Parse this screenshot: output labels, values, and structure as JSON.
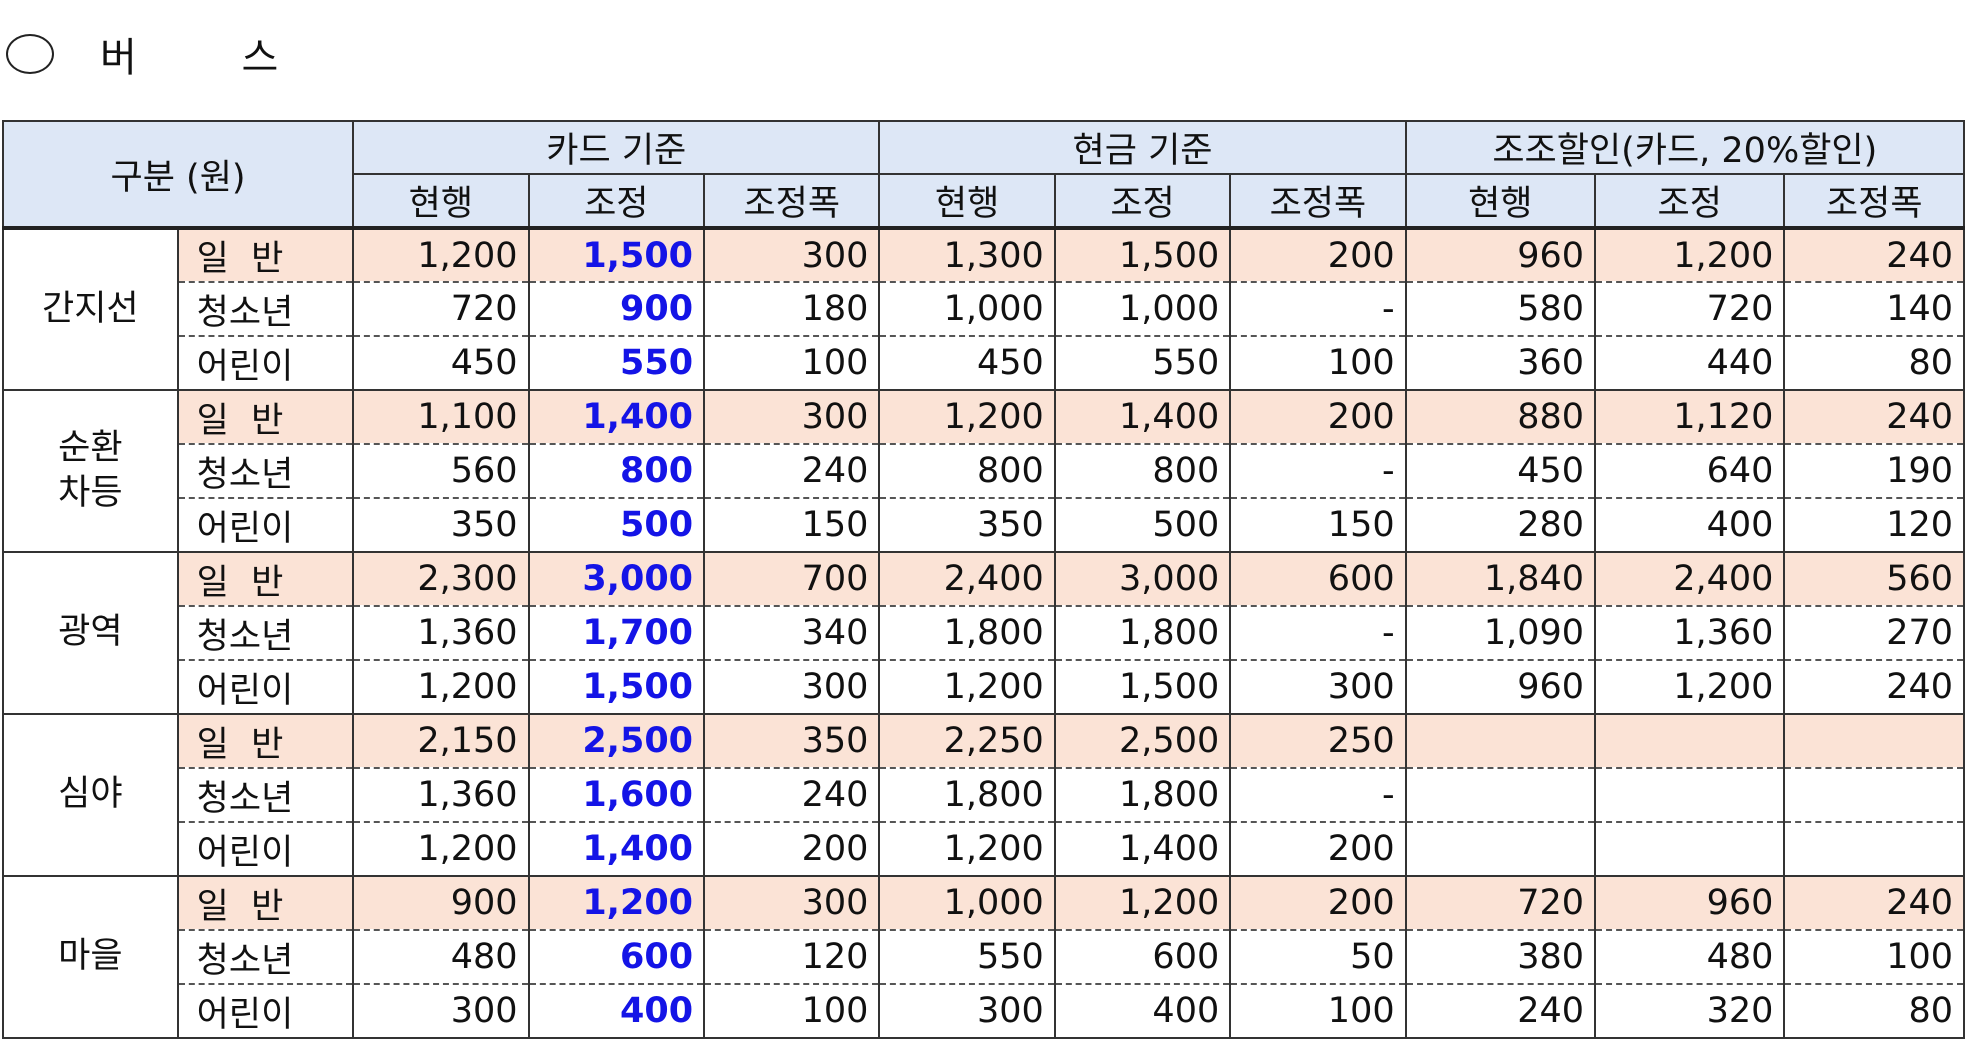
{
  "title": {
    "symbol": "○",
    "text": "버 스"
  },
  "table": {
    "header": {
      "corner": "구분 (원)",
      "groups": [
        "카드 기준",
        "현금 기준",
        "조조할인(카드, 20%할인)"
      ],
      "sub": [
        "현행",
        "조정",
        "조정폭",
        "현행",
        "조정",
        "조정폭",
        "현행",
        "조정",
        "조정폭"
      ]
    },
    "groups": [
      {
        "name": "간지선",
        "rows": [
          {
            "label": "일  반",
            "values": [
              "1,200",
              "1,500",
              "300",
              "1,300",
              "1,500",
              "200",
              "960",
              "1,200",
              "240"
            ]
          },
          {
            "label": "청소년",
            "values": [
              "720",
              "900",
              "180",
              "1,000",
              "1,000",
              "-",
              "580",
              "720",
              "140"
            ]
          },
          {
            "label": "어린이",
            "values": [
              "450",
              "550",
              "100",
              "450",
              "550",
              "100",
              "360",
              "440",
              "80"
            ]
          }
        ]
      },
      {
        "name": "순환\n차등",
        "rows": [
          {
            "label": "일  반",
            "values": [
              "1,100",
              "1,400",
              "300",
              "1,200",
              "1,400",
              "200",
              "880",
              "1,120",
              "240"
            ]
          },
          {
            "label": "청소년",
            "values": [
              "560",
              "800",
              "240",
              "800",
              "800",
              "-",
              "450",
              "640",
              "190"
            ]
          },
          {
            "label": "어린이",
            "values": [
              "350",
              "500",
              "150",
              "350",
              "500",
              "150",
              "280",
              "400",
              "120"
            ]
          }
        ]
      },
      {
        "name": "광역",
        "rows": [
          {
            "label": "일  반",
            "values": [
              "2,300",
              "3,000",
              "700",
              "2,400",
              "3,000",
              "600",
              "1,840",
              "2,400",
              "560"
            ]
          },
          {
            "label": "청소년",
            "values": [
              "1,360",
              "1,700",
              "340",
              "1,800",
              "1,800",
              "-",
              "1,090",
              "1,360",
              "270"
            ]
          },
          {
            "label": "어린이",
            "values": [
              "1,200",
              "1,500",
              "300",
              "1,200",
              "1,500",
              "300",
              "960",
              "1,200",
              "240"
            ]
          }
        ]
      },
      {
        "name": "심야",
        "rows": [
          {
            "label": "일  반",
            "values": [
              "2,150",
              "2,500",
              "350",
              "2,250",
              "2,500",
              "250",
              "",
              "",
              ""
            ]
          },
          {
            "label": "청소년",
            "values": [
              "1,360",
              "1,600",
              "240",
              "1,800",
              "1,800",
              "-",
              "",
              "",
              ""
            ]
          },
          {
            "label": "어린이",
            "values": [
              "1,200",
              "1,400",
              "200",
              "1,200",
              "1,400",
              "200",
              "",
              "",
              ""
            ]
          }
        ]
      },
      {
        "name": "마을",
        "rows": [
          {
            "label": "일  반",
            "values": [
              "900",
              "1,200",
              "300",
              "1,000",
              "1,200",
              "200",
              "720",
              "960",
              "240"
            ]
          },
          {
            "label": "청소년",
            "values": [
              "480",
              "600",
              "120",
              "550",
              "600",
              "50",
              "380",
              "480",
              "100"
            ]
          },
          {
            "label": "어린이",
            "values": [
              "300",
              "400",
              "100",
              "300",
              "400",
              "100",
              "240",
              "320",
              "80"
            ]
          }
        ]
      }
    ]
  },
  "colors": {
    "header_bg": "#dde7f6",
    "general_row_bg": "#fbe3d6",
    "adjusted_card_text": "#1414e6"
  }
}
